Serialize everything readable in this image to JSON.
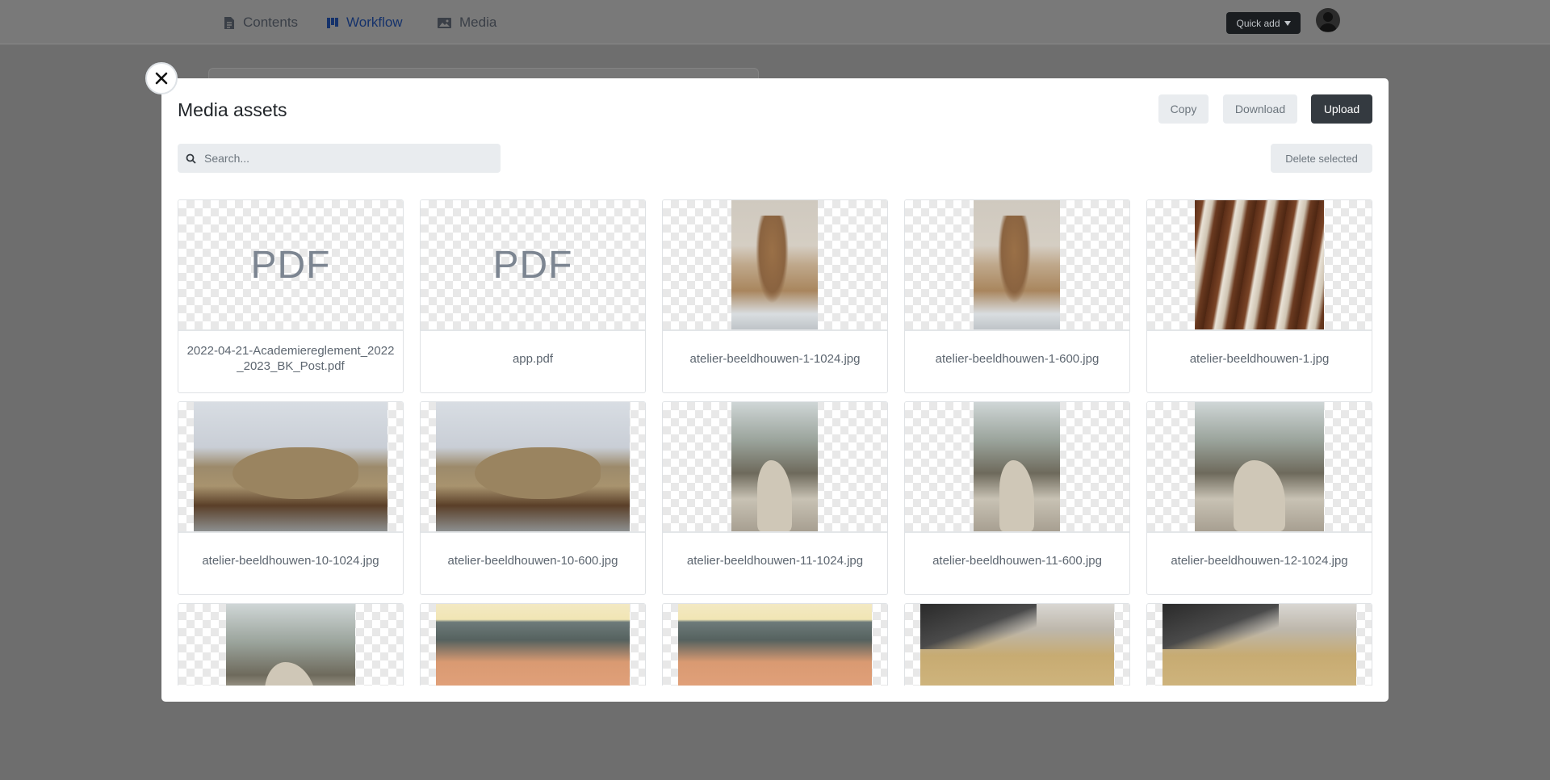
{
  "nav": {
    "items": [
      {
        "label": "Contents",
        "icon": "document-icon"
      },
      {
        "label": "Workflow",
        "icon": "kanban-icon"
      },
      {
        "label": "Media",
        "icon": "image-icon"
      }
    ],
    "quick_add": "Quick add"
  },
  "modal": {
    "title": "Media assets",
    "buttons": {
      "copy": "Copy",
      "download": "Download",
      "upload": "Upload",
      "delete_selected": "Delete selected"
    },
    "search": {
      "placeholder": "Search...",
      "value": ""
    },
    "pdf_badge": "PDF",
    "assets": [
      {
        "name": "2022-04-21-Academiereglement_2022_2023_BK_Post.pdf",
        "type": "pdf"
      },
      {
        "name": "app.pdf",
        "type": "pdf"
      },
      {
        "name": "atelier-beeldhouwen-1-1024.jpg",
        "type": "image"
      },
      {
        "name": "atelier-beeldhouwen-1-600.jpg",
        "type": "image"
      },
      {
        "name": "atelier-beeldhouwen-1.jpg",
        "type": "image"
      },
      {
        "name": "atelier-beeldhouwen-10-1024.jpg",
        "type": "image"
      },
      {
        "name": "atelier-beeldhouwen-10-600.jpg",
        "type": "image"
      },
      {
        "name": "atelier-beeldhouwen-11-1024.jpg",
        "type": "image"
      },
      {
        "name": "atelier-beeldhouwen-11-600.jpg",
        "type": "image"
      },
      {
        "name": "atelier-beeldhouwen-12-1024.jpg",
        "type": "image"
      },
      {
        "name": "",
        "type": "image"
      },
      {
        "name": "",
        "type": "image"
      },
      {
        "name": "",
        "type": "image"
      },
      {
        "name": "",
        "type": "image"
      },
      {
        "name": "",
        "type": "image"
      }
    ]
  },
  "colors": {
    "accent_dark": "#343a40",
    "nav_active": "#15326b",
    "light_button": "#e9ecef"
  }
}
